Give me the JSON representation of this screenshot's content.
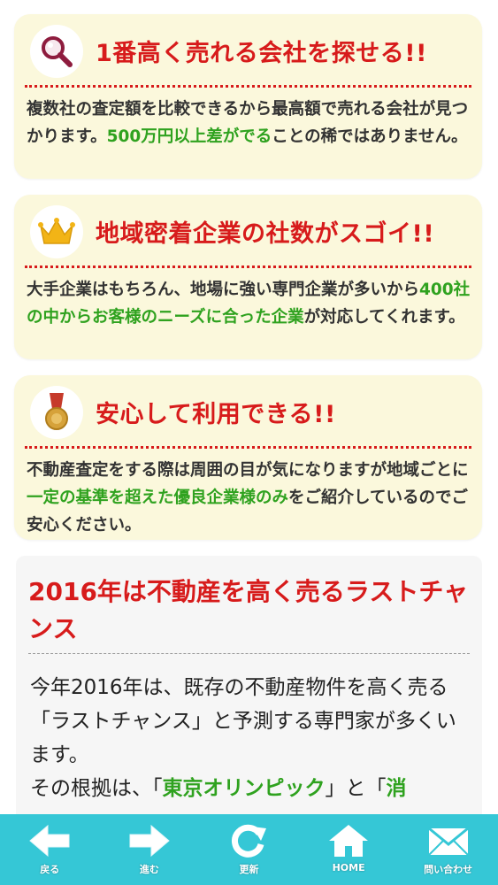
{
  "features": [
    {
      "icon": "magnifier-icon",
      "title": "1番高く売れる会社を探せる!!",
      "text_before": "複数社の査定額を比較できるから最高額で売れる会社が見つかります。",
      "highlight": "500万円以上差がでる",
      "text_after": "ことの稀ではありません。"
    },
    {
      "icon": "crown-icon",
      "title": "地域密着企業の社数がスゴイ!!",
      "text_before": "大手企業はもちろん、地場に強い専門企業が多いから",
      "highlight": "400社の中からお客様のニーズに合った企業",
      "text_after": "が対応してくれます。"
    },
    {
      "icon": "medal-icon",
      "title": "安心して利用できる!!",
      "text_before": "不動産査定をする際は周囲の目が気になりますが地域ごとに",
      "highlight": "一定の基準を超えた優良企業様のみ",
      "text_after": "をご紹介しているのでご安心ください。"
    }
  ],
  "article": {
    "headline": "2016年は不動産を高く売るラストチャンス",
    "para1": "今年2016年は、既存の不動産物件を高く売る「ラストチャンス」と予測する専門家が多くいます。",
    "para2_before": "その根拠は、「",
    "para2_highlight": "東京オリンピック",
    "para2_mid": "」と「",
    "para2_highlight2": "消"
  },
  "nav": [
    {
      "label": "戻る",
      "icon": "back-arrow-icon"
    },
    {
      "label": "進む",
      "icon": "forward-arrow-icon"
    },
    {
      "label": "更新",
      "icon": "refresh-icon"
    },
    {
      "label": "HOME",
      "icon": "home-icon"
    },
    {
      "label": "問い合わせ",
      "icon": "mail-icon"
    }
  ],
  "colors": {
    "card_bg": "#fbf8dc",
    "title_red": "#d71b1b",
    "highlight_green": "#2fa21f",
    "nav_bg": "#35c7d6"
  }
}
